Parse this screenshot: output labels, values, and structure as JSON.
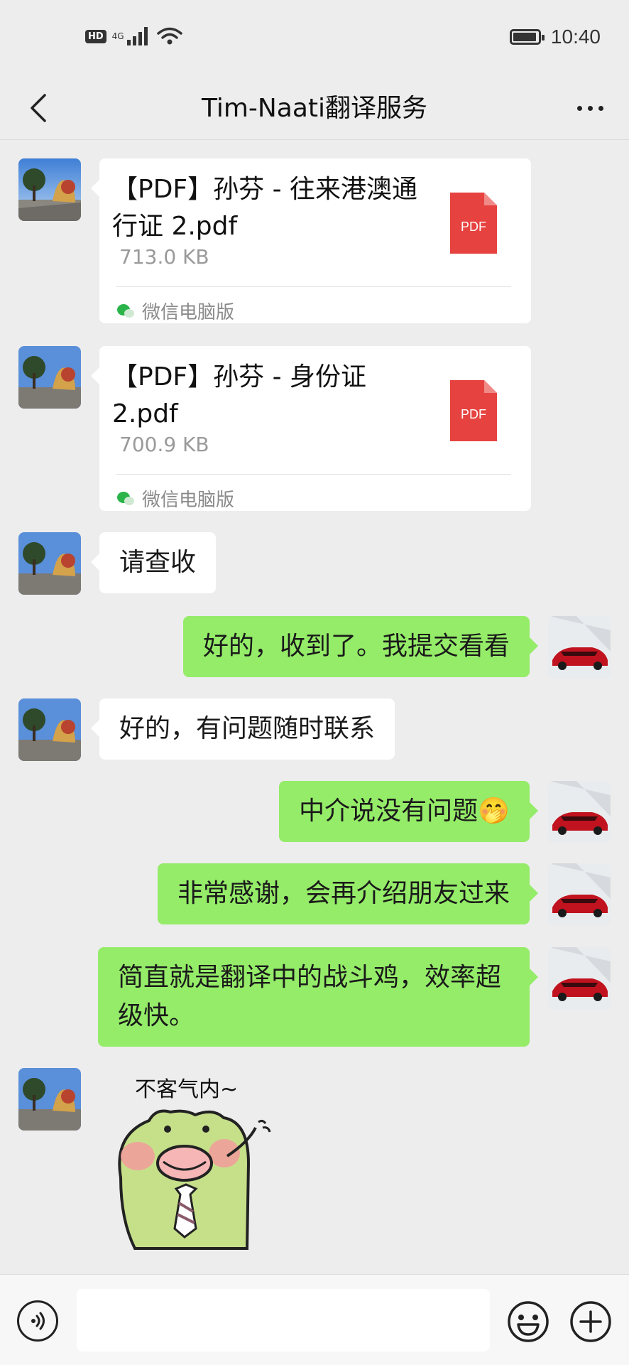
{
  "status_bar": {
    "hd": "HD",
    "network": "4G",
    "time": "10:40"
  },
  "nav": {
    "title": "Tim-Naati翻译服务",
    "back_icon": "chevron-left-icon",
    "more_icon": "more-dots-icon"
  },
  "messages": [
    {
      "type": "file",
      "sender": "contact",
      "name": "【PDF】孙芬 - 往来港澳通行证 2.pdf",
      "size": "713.0 KB",
      "icon_label": "PDF",
      "source": "微信电脑版"
    },
    {
      "type": "file",
      "sender": "contact",
      "name": "【PDF】孙芬 - 身份证 2.pdf",
      "size": "700.9 KB",
      "icon_label": "PDF",
      "source": "微信电脑版"
    },
    {
      "type": "text",
      "sender": "contact",
      "text": "请查收"
    },
    {
      "type": "text",
      "sender": "me",
      "text": "好的，收到了。我提交看看"
    },
    {
      "type": "text",
      "sender": "contact",
      "text": "好的，有问题随时联系"
    },
    {
      "type": "text",
      "sender": "me",
      "text": "中介说没有问题🤭"
    },
    {
      "type": "text",
      "sender": "me",
      "text": "非常感谢，会再介绍朋友过来"
    },
    {
      "type": "text",
      "sender": "me",
      "text": "简直就是翻译中的战斗鸡，效率超级快。"
    },
    {
      "type": "sticker",
      "sender": "contact",
      "caption": "不客气内~"
    }
  ],
  "input_bar": {
    "placeholder": "",
    "voice_icon": "voice-icon",
    "emoji_icon": "emoji-icon",
    "plus_icon": "plus-icon"
  },
  "colors": {
    "background": "#ededed",
    "outgoing_bubble": "#95ec69",
    "incoming_bubble": "#ffffff",
    "pdf_red": "#e64340"
  }
}
